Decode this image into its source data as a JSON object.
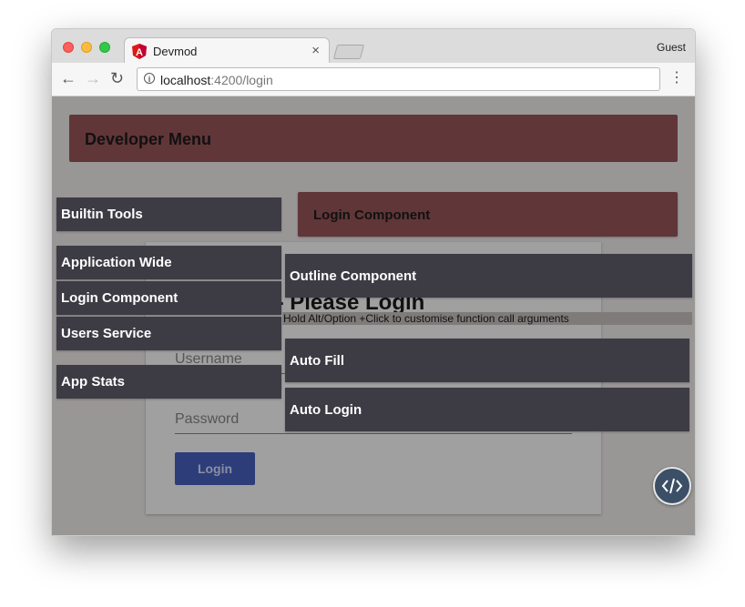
{
  "browser": {
    "tab_title": "Devmod",
    "tab_close": "×",
    "profile": "Guest",
    "url_host": "localhost",
    "url_rest": ":4200/login",
    "nav": {
      "back": "←",
      "forward": "→",
      "reload": "↻",
      "menu": "⋮"
    },
    "info_icon": "i"
  },
  "page": {
    "developer_menu_title": "Developer Menu",
    "component_header": "Login Component",
    "login_card": {
      "title": "Welcome - Please Login",
      "username_placeholder": "Username",
      "password_placeholder": "Password",
      "login_label": "Login"
    },
    "left_menu": [
      "Builtin Tools",
      "Application Wide",
      "Login Component",
      "Users Service",
      "App Stats"
    ],
    "right_menu": [
      "Outline Component",
      "Auto Fill",
      "Auto Login"
    ],
    "hint": "Hold Alt/Option +Click to customise function call arguments"
  },
  "colors": {
    "menu_header": "#613638",
    "panel": "#3d3c44",
    "overlay": "#999696",
    "login_button": "#2c3d79",
    "fab": "#3b5066"
  },
  "icons": [
    "angular-icon",
    "close-icon",
    "back-arrow-icon",
    "forward-arrow-icon",
    "reload-icon",
    "info-icon",
    "more-vert-icon",
    "code-icon"
  ]
}
